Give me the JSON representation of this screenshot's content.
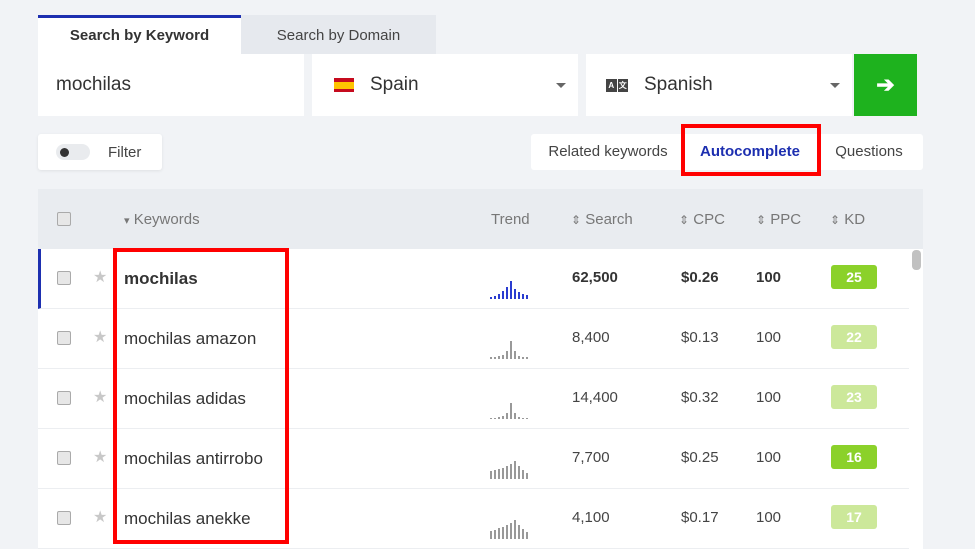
{
  "tabs": {
    "search_by_keyword": "Search by Keyword",
    "search_by_domain": "Search by Domain"
  },
  "search": {
    "keyword_value": "mochilas",
    "country": "Spain",
    "language": "Spanish",
    "language_icon_a": "A",
    "language_icon_b": "文",
    "go_arrow": "➔"
  },
  "filter": {
    "label": "Filter"
  },
  "mode_tabs": {
    "related": "Related keywords",
    "autocomplete": "Autocomplete",
    "questions": "Questions"
  },
  "table": {
    "headers": {
      "keywords": "Keywords",
      "trend": "Trend",
      "search": "Search",
      "cpc": "CPC",
      "ppc": "PPC",
      "kd": "KD"
    },
    "sort_arrow": "▾",
    "sort_icon": "⇕",
    "star": "★",
    "rows": [
      {
        "keyword": "mochilas",
        "search": "62,500",
        "cpc": "$0.26",
        "ppc": "100",
        "kd": "25",
        "kd_color": "#8bd12a",
        "trend": [
          2,
          3,
          5,
          8,
          12,
          18,
          10,
          7,
          5,
          4
        ]
      },
      {
        "keyword": "mochilas amazon",
        "search": "8,400",
        "cpc": "$0.13",
        "ppc": "100",
        "kd": "22",
        "kd_color": "#cce89a",
        "trend": [
          2,
          2,
          3,
          4,
          8,
          18,
          8,
          3,
          2,
          2
        ]
      },
      {
        "keyword": "mochilas adidas",
        "search": "14,400",
        "cpc": "$0.32",
        "ppc": "100",
        "kd": "23",
        "kd_color": "#cce89a",
        "trend": [
          1,
          1,
          2,
          3,
          6,
          16,
          6,
          2,
          1,
          1
        ]
      },
      {
        "keyword": "mochilas antirrobo",
        "search": "7,700",
        "cpc": "$0.25",
        "ppc": "100",
        "kd": "16",
        "kd_color": "#8bd12a",
        "trend": [
          8,
          9,
          10,
          11,
          13,
          15,
          18,
          13,
          9,
          6
        ]
      },
      {
        "keyword": "mochilas anekke",
        "search": "4,100",
        "cpc": "$0.17",
        "ppc": "100",
        "kd": "17",
        "kd_color": "#cce89a",
        "trend": [
          8,
          9,
          11,
          12,
          14,
          16,
          19,
          14,
          10,
          7
        ]
      }
    ]
  }
}
